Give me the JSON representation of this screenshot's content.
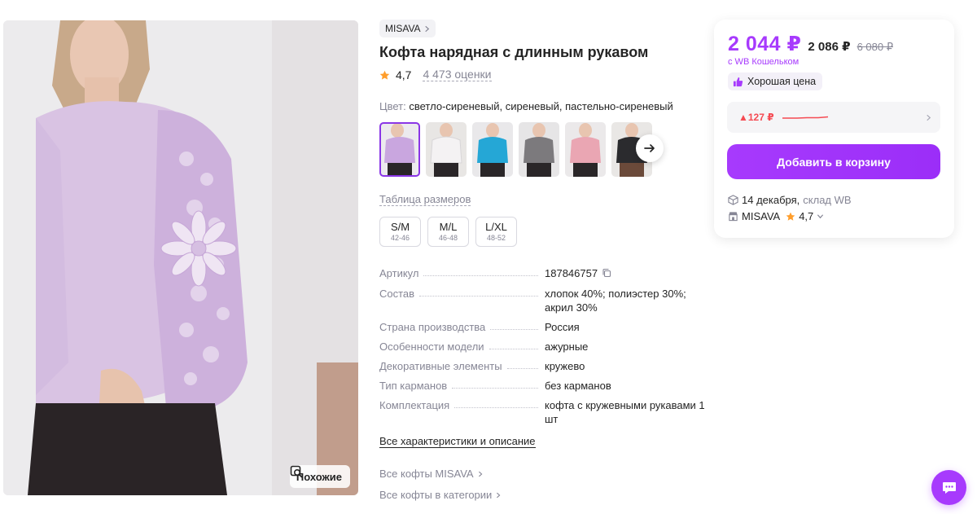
{
  "product": {
    "brand": "MISAVA",
    "title": "Кофта нарядная с длинным рукавом",
    "rating": "4,7",
    "reviews": "4 473 оценки",
    "color_label": "Цвет:",
    "color_value": "светло-сиреневый, сиреневый, пастельно-сиреневый",
    "thumb_colors": [
      "#c9a6df",
      "#f4f2f3",
      "#25a7d6",
      "#7c7a7d",
      "#eaa6b3",
      "#2b2b2e"
    ],
    "similar_label": "Похожие"
  },
  "sizes": {
    "table_link": "Таблица размеров",
    "items": [
      {
        "size": "S/M",
        "range": "42-46"
      },
      {
        "size": "M/L",
        "range": "46-48"
      },
      {
        "size": "L/XL",
        "range": "48-52"
      }
    ]
  },
  "specs": [
    {
      "key": "Артикул",
      "value": "187846757"
    },
    {
      "key": "Состав",
      "value": "хлопок 40%; полиэстер 30%; акрил 30%"
    },
    {
      "key": "Страна производства",
      "value": "Россия"
    },
    {
      "key": "Особенности модели",
      "value": "ажурные"
    },
    {
      "key": "Декоративные элементы",
      "value": "кружево"
    },
    {
      "key": "Тип карманов",
      "value": "без карманов"
    },
    {
      "key": "Комплектация",
      "value": "кофта с кружевными рукавами 1 шт"
    }
  ],
  "links": {
    "all_characteristics": "Все характеристики и описание",
    "all_brand": "Все кофты MISAVA",
    "all_category": "Все кофты в категории"
  },
  "price": {
    "current": "2 044 ₽",
    "old": "2 086 ₽",
    "crossed": "6 080 ₽",
    "wallet": "с WB Кошельком",
    "good_price": "Хорошая цена",
    "history_delta": "▲127 ₽",
    "add_to_cart": "Добавить в корзину",
    "delivery_date": "14 декабря,",
    "delivery_store": "склад WB",
    "seller": "MISAVA",
    "seller_rating": "4,7"
  },
  "colors": {
    "accent": "#a73afd",
    "text": "#242424",
    "muted": "#868695",
    "price_up": "#f54a52"
  }
}
